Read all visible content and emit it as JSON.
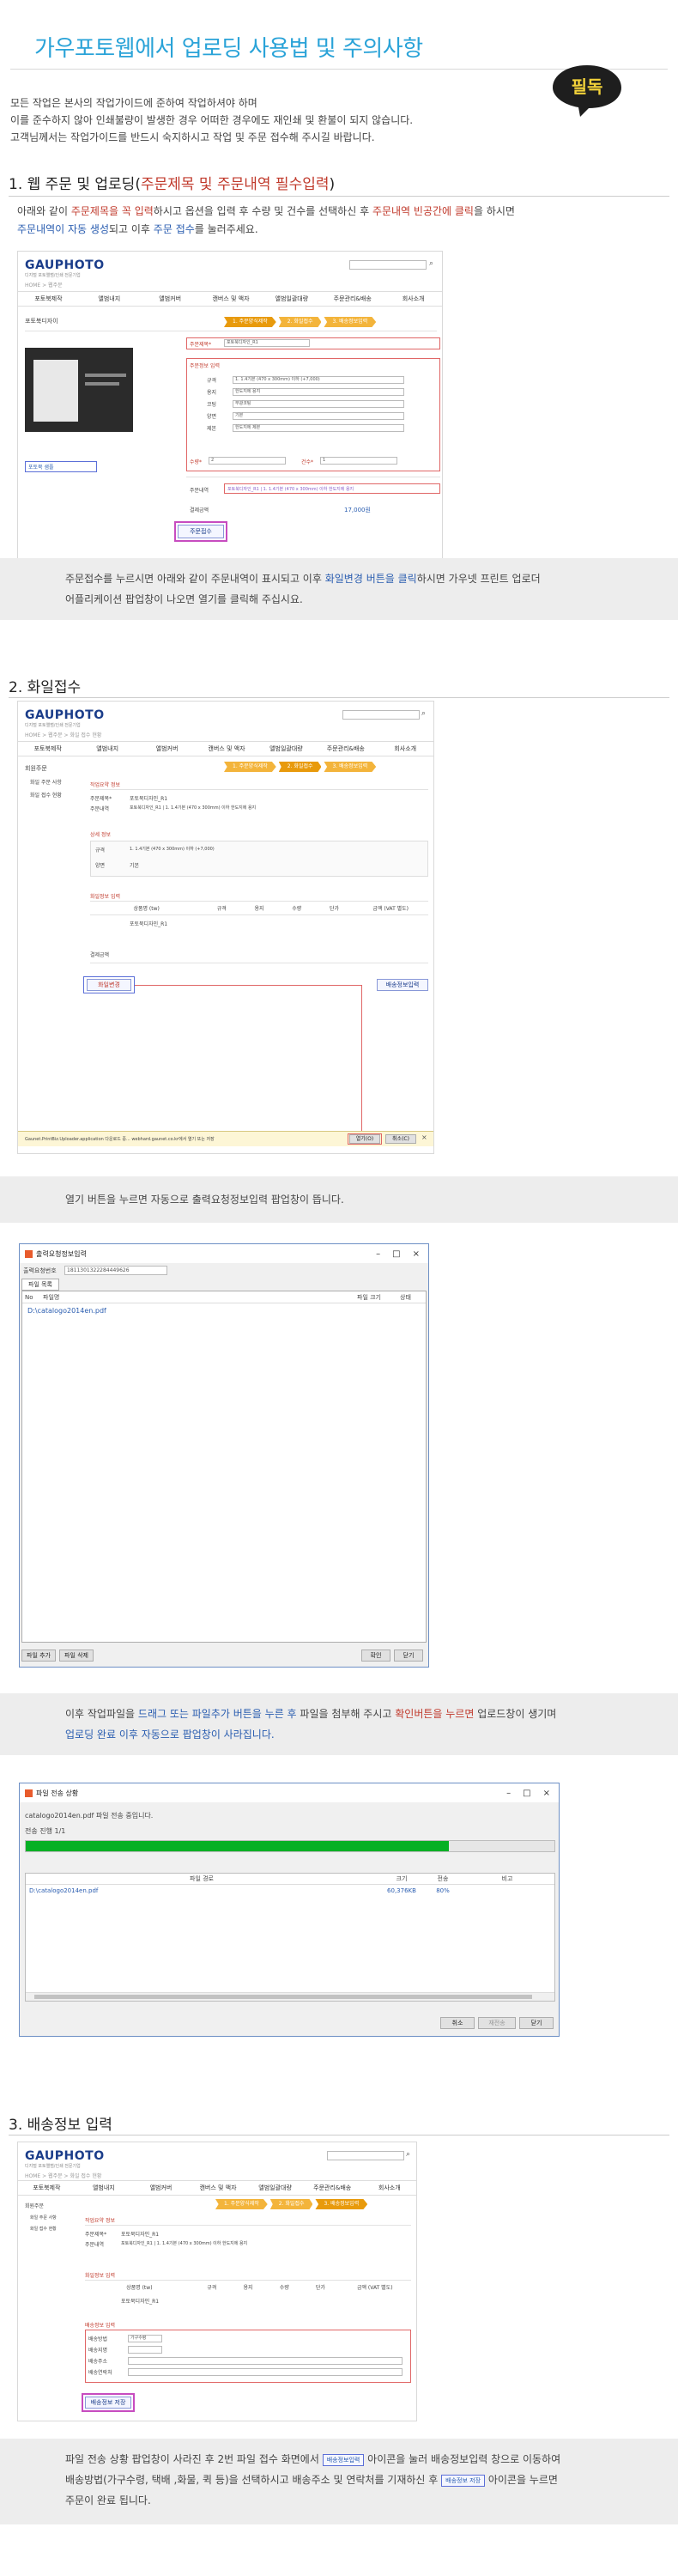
{
  "header": {
    "title": "가우포토웹에서 업로딩 사용법 및 주의사항",
    "badge": "필독",
    "intro": [
      "모든 작업은 본사의 작업가이드에 준하여 작업하셔야 하며",
      "이를 준수하지 않아 인쇄불량이 발생한 경우 어떠한 경우에도 재인쇄 및 환불이 되지 않습니다.",
      "고객님께서는 작업가이드를 반드시 숙지하시고 작업 및 주문 접수해 주시길 바랍니다."
    ]
  },
  "section1": {
    "title_a": "1. 웹 주문 및 업로딩(",
    "title_b": "주문제목 및 주문내역 필수입력",
    "title_c": ")",
    "desc": {
      "p1": "아래와 같이 ",
      "p2": "주문제목을 꼭 입력",
      "p3": "하시고 옵션을 입력 후 수량 및 건수를 선택하신 후 ",
      "p4": "주문내역 빈공간에 클릭",
      "p5": "을 하시면",
      "p6": "주문내역이 자동 생성",
      "p7": "되고 이후 ",
      "p8": "주문 접수",
      "p9": "를 눌러주세요."
    },
    "band": {
      "p1": "주문접수를 누르시면 아래와 같이 주문내역이 표시되고 이후 ",
      "p2": "화일변경 버튼을 클릭",
      "p3": "하시면 가우넷 프린트 업로더",
      "p4": "어플리케이션 팝업창이 나오면 열기를 클릭해 주십시요."
    }
  },
  "section2": {
    "title": "2. 화일접수",
    "band1": "열기 버튼을 누르면 자동으로 출력요청정보입력 팝업창이 뜹니다.",
    "band2": {
      "p1": "이후 작업파일을 ",
      "p2": "드래그 또는 파일추가 버튼을 누른 후",
      "p3": " 파일을 첨부해 주시고 ",
      "p4": "확인버튼을 누르면",
      "p5": " 업로드창이 생기며",
      "p6": "업로딩 완료 이후 자동으로 팝업창이 사라집니다."
    }
  },
  "section3": {
    "title": "3. 배송정보 입력",
    "band": {
      "p1": "파일 전송 상황 팝업창이 사라진 후 2번 파일 접수 화면에서 ",
      "btn1": "배송정보입력",
      "p2": " 아이콘을 눌러 배송정보입력 창으로 이동하여",
      "p3": "배송방법(가구수령, 택배 ,화물, 퀵 등)을 선택하시고 배송주소 및 연락처를 기재하신 후 ",
      "btn2": "배송정보 저장",
      "p4": " 아이콘을 누르면",
      "p5": "주문이 완료 됩니다."
    }
  },
  "site": {
    "logo": "GAUPHOTO",
    "logo_sub": "디지털 포토앨범/인쇄 전문기업",
    "breadcrumb": "HOME > 웹주문",
    "breadcrumb2": "HOME > 웹주문 > 화일 접수 현황",
    "search_icon": "search-icon",
    "nav": [
      "포토북제작",
      "앨범내지",
      "앨범커버",
      "캔버스 및 액자",
      "앨범일괄대량",
      "주문관리&배송",
      "회사소개"
    ],
    "sidebar_title": "포토북디자이",
    "sidebar2": [
      "회원주문",
      "화일 주문 사항",
      "화일 접수 현황"
    ],
    "steps": [
      "1. 주문양식제작",
      "2. 화일접수",
      "3. 배송정보입력"
    ],
    "order_title_label": "주문제목*",
    "order_title_value": "포토북디자인_R1",
    "option_header": "주문정보 입력",
    "options": [
      {
        "label": "규격",
        "value": "1. 1.4기본 (470 x 300mm) 이하 (+7,000)"
      },
      {
        "label": "용지",
        "value": "한도지에 용지"
      },
      {
        "label": "코팅",
        "value": "무광코팅"
      },
      {
        "label": "양면",
        "value": "기본"
      },
      {
        "label": "제본",
        "value": "한도지에 제본"
      }
    ],
    "qty_label": "수량*",
    "qty_value": "2",
    "count_label": "건수*",
    "count_value": "1",
    "history_label": "주문내역",
    "history_value": "포토북디자인_R1 | 1. 1.4기본 (470 x 300mm) 이하 한도지에 용지",
    "amount_label": "결제금액",
    "amount_value": "17,000원",
    "submit_btn": "주문접수",
    "sample_caption": "포토북 샘플",
    "file_change_btn": "화일변경",
    "delivery_btn": "배송정보입력",
    "app_bar": "Gaunet.PrintBiz.Uploader.application 다운로드 중... webhard.gaunet.co.kr에서 열기 또는 저장",
    "app_open": "열기(O)",
    "app_cancel": "취소(C)",
    "order_info_title": "작업요약 정보",
    "detail_title": "상세 정보",
    "file_info_title": "화일정보 입력",
    "table_headers": [
      "상품명 (tw)",
      "규격",
      "용지",
      "수량",
      "단가",
      "금액 (VAT 별도)"
    ],
    "delivery_title": "배송정보 입력",
    "delivery_fields": [
      "배송방법",
      "배송지명",
      "배송주소",
      "배송연락처"
    ],
    "delivery_method_value": "가구수령",
    "delivery_save_btn": "배송정보 저장"
  },
  "dialog1": {
    "title": "출력요청정보입력",
    "order_no_label": "출력요청번호",
    "order_no_value": "1811301322284449626",
    "menu": "파일 목록",
    "col_no": "No",
    "col_file": "파일명",
    "col_size": "파일 크기",
    "col_status": "상태",
    "file_row": "D:\\catalogo2014en.pdf",
    "btn_add": "파일 추가",
    "btn_delete": "파일 삭제",
    "btn_ok": "확인",
    "btn_close": "닫기"
  },
  "dialog2": {
    "title": "파일 전송 상황",
    "status_line": "catalogo2014en.pdf 파일 전송 중입니다.",
    "progress_line": "전송 진행 1/1",
    "col_path": "파일 경로",
    "col_size": "크기",
    "col_sent": "전송",
    "col_note": "비고",
    "row_path": "D:\\catalogo2014en.pdf",
    "row_size": "60,376KB",
    "row_sent": "80%",
    "progress_fraction": 0.8,
    "btn_cancel": "취소",
    "btn_resend": "재전송",
    "btn_close": "닫기"
  },
  "colors": {
    "title": "#2aa3d8",
    "accent_red": "#c0392b",
    "accent_blue": "#2a5db0",
    "badge_bg": "#1e1e1e",
    "badge_text": "#f3d23a",
    "step": "#f3b43b"
  }
}
